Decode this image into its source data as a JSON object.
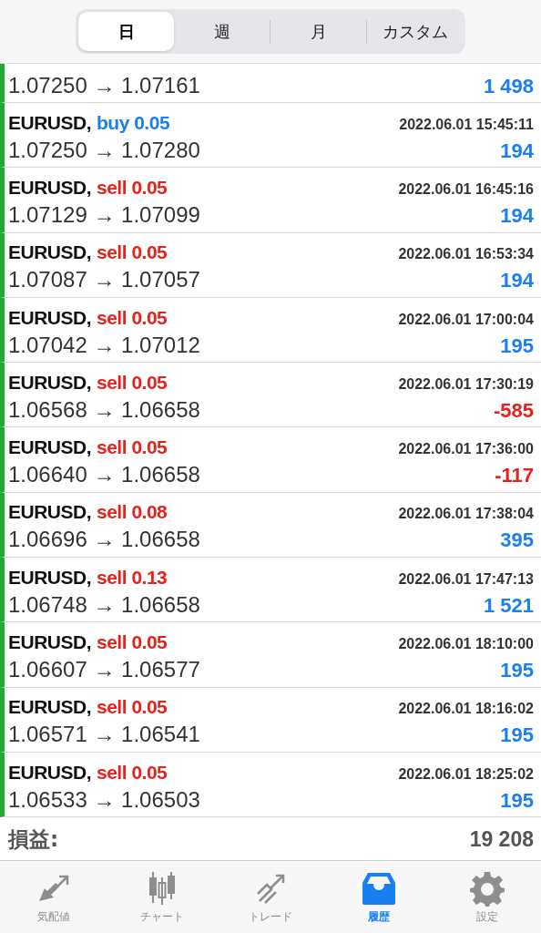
{
  "period_tabs": [
    {
      "label": "日",
      "selected": true
    },
    {
      "label": "週",
      "selected": false
    },
    {
      "label": "月",
      "selected": false
    },
    {
      "label": "カスタム",
      "selected": false
    }
  ],
  "partial_row": {
    "prices": "1.07250 → 1.07161",
    "profit": "1 498",
    "negative": false
  },
  "trades": [
    {
      "symbol": "EURUSD,",
      "side": "buy",
      "lots": "0.05",
      "color": "#1a7ff0",
      "time": "2022.06.01 15:45:11",
      "prices": "1.07250 → 1.07280",
      "profit": "194",
      "negative": false
    },
    {
      "symbol": "EURUSD,",
      "side": "sell",
      "lots": "0.05",
      "color": "#e5221c",
      "time": "2022.06.01 16:45:16",
      "prices": "1.07129 → 1.07099",
      "profit": "194",
      "negative": false
    },
    {
      "symbol": "EURUSD,",
      "side": "sell",
      "lots": "0.05",
      "color": "#e5221c",
      "time": "2022.06.01 16:53:34",
      "prices": "1.07087 → 1.07057",
      "profit": "194",
      "negative": false
    },
    {
      "symbol": "EURUSD,",
      "side": "sell",
      "lots": "0.05",
      "color": "#e5221c",
      "time": "2022.06.01 17:00:04",
      "prices": "1.07042 → 1.07012",
      "profit": "195",
      "negative": false
    },
    {
      "symbol": "EURUSD,",
      "side": "sell",
      "lots": "0.05",
      "color": "#e5221c",
      "time": "2022.06.01 17:30:19",
      "prices": "1.06568 → 1.06658",
      "profit": "-585",
      "negative": true
    },
    {
      "symbol": "EURUSD,",
      "side": "sell",
      "lots": "0.05",
      "color": "#e5221c",
      "time": "2022.06.01 17:36:00",
      "prices": "1.06640 → 1.06658",
      "profit": "-117",
      "negative": true
    },
    {
      "symbol": "EURUSD,",
      "side": "sell",
      "lots": "0.08",
      "color": "#e5221c",
      "time": "2022.06.01 17:38:04",
      "prices": "1.06696 → 1.06658",
      "profit": "395",
      "negative": false
    },
    {
      "symbol": "EURUSD,",
      "side": "sell",
      "lots": "0.13",
      "color": "#e5221c",
      "time": "2022.06.01 17:47:13",
      "prices": "1.06748 → 1.06658",
      "profit": "1 521",
      "negative": false
    },
    {
      "symbol": "EURUSD,",
      "side": "sell",
      "lots": "0.05",
      "color": "#e5221c",
      "time": "2022.06.01 18:10:00",
      "prices": "1.06607 → 1.06577",
      "profit": "195",
      "negative": false
    },
    {
      "symbol": "EURUSD,",
      "side": "sell",
      "lots": "0.05",
      "color": "#e5221c",
      "time": "2022.06.01 18:16:02",
      "prices": "1.06571 → 1.06541",
      "profit": "195",
      "negative": false
    },
    {
      "symbol": "EURUSD,",
      "side": "sell",
      "lots": "0.05",
      "color": "#e5221c",
      "time": "2022.06.01 18:25:02",
      "prices": "1.06533 → 1.06503",
      "profit": "195",
      "negative": false
    }
  ],
  "summary": {
    "label": "損益:",
    "value": "19 208"
  },
  "tab_bar": [
    {
      "label": "気配値",
      "kind": "quotes",
      "selected": false
    },
    {
      "label": "チャート",
      "kind": "chart",
      "selected": false
    },
    {
      "label": "トレード",
      "kind": "trade",
      "selected": false
    },
    {
      "label": "履歴",
      "kind": "history",
      "selected": true
    },
    {
      "label": "設定",
      "kind": "settings",
      "selected": false
    }
  ]
}
